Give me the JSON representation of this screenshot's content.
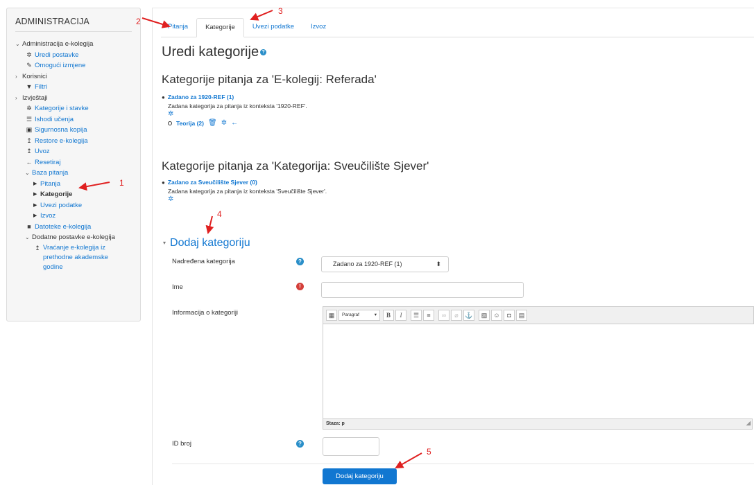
{
  "sidebar": {
    "title": "ADMINISTRACIJA",
    "items": [
      {
        "label": "Administracija e-kolegija"
      },
      {
        "label": "Uredi postavke"
      },
      {
        "label": "Omogući izmjene"
      },
      {
        "label": "Korisnici"
      },
      {
        "label": "Filtri"
      },
      {
        "label": "Izvještaji"
      },
      {
        "label": "Kategorije i stavke"
      },
      {
        "label": "Ishodi učenja"
      },
      {
        "label": "Sigurnosna kopija"
      },
      {
        "label": "Restore e-kolegija"
      },
      {
        "label": "Uvoz"
      },
      {
        "label": "Resetiraj"
      },
      {
        "label": "Baza pitanja"
      },
      {
        "label": "Pitanja"
      },
      {
        "label": "Kategorije"
      },
      {
        "label": "Uvezi podatke"
      },
      {
        "label": "Izvoz"
      },
      {
        "label": "Datoteke e-kolegija"
      },
      {
        "label": "Dodatne postavke e-kolegija"
      },
      {
        "label": "Vraćanje e-kolegija iz prethodne akademske godine"
      }
    ]
  },
  "tabs": [
    {
      "label": "Pitanja"
    },
    {
      "label": "Kategorije"
    },
    {
      "label": "Uvezi podatke"
    },
    {
      "label": "Izvoz"
    }
  ],
  "page": {
    "title": "Uredi kategorije",
    "section1": {
      "heading": "Kategorije pitanja za 'E-kolegij: Referada'",
      "default_link": "Zadano za 1920-REF (1)",
      "default_desc": "Zadana kategorija za pitanja iz konteksta '1920-REF'.",
      "sub_link": "Teorija (2)"
    },
    "section2": {
      "heading": "Kategorije pitanja za 'Kategorija: Sveučilište Sjever'",
      "default_link": "Zadano za Sveučilište Sjever (0)",
      "default_desc": "Zadana kategorija za pitanja iz konteksta 'Sveučilište Sjever'."
    }
  },
  "form": {
    "legend": "Dodaj kategoriju",
    "parent_label": "Nadređena kategorija",
    "parent_value": "Zadano za 1920-REF (1)",
    "name_label": "Ime",
    "name_value": "",
    "info_label": "Informacija o kategoriji",
    "editor_format": "Paragraf",
    "editor_path": "Staza: p",
    "id_label": "ID broj",
    "id_value": "",
    "submit_label": "Dodaj kategoriju"
  },
  "annotations": [
    "1",
    "2",
    "3",
    "4",
    "5"
  ],
  "colors": {
    "link": "#1177d1",
    "annotation": "#e02020",
    "required": "#d43f3a"
  }
}
